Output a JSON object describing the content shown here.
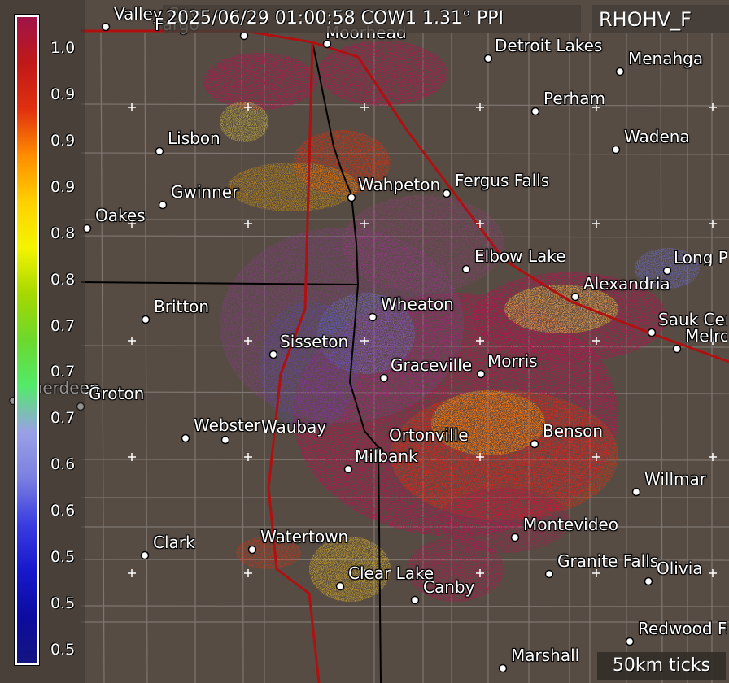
{
  "header": {
    "title": "2025/06/29 01:00:58 COW1 1.31° PPI",
    "product": "RHOHV_F",
    "scale_note": "50km ticks"
  },
  "legend": {
    "ticks": [
      "1.0",
      "0.9",
      "0.9",
      "0.9",
      "0.8",
      "0.8",
      "0.7",
      "0.7",
      "0.7",
      "0.6",
      "0.6",
      "0.5",
      "0.5",
      "0.5"
    ],
    "colors": [
      "#a0144a",
      "#c01818",
      "#e03010",
      "#ff8c00",
      "#ffd000",
      "#f4f400",
      "#a6d800",
      "#6cd82c",
      "#52ea6a",
      "#9aa0e6",
      "#7a80e0",
      "#3a3ce0",
      "#1818cc",
      "#0c0ca0",
      "#141480"
    ]
  },
  "cities": [
    {
      "name": "Valley City"
    },
    {
      "name": "Fargo"
    },
    {
      "name": "Moorhead"
    },
    {
      "name": "Detroit Lakes"
    },
    {
      "name": "Menahga"
    },
    {
      "name": "Perham"
    },
    {
      "name": "Lisbon"
    },
    {
      "name": "Wadena"
    },
    {
      "name": "Gwinner"
    },
    {
      "name": "Wahpeton"
    },
    {
      "name": "Fergus Falls"
    },
    {
      "name": "Oakes"
    },
    {
      "name": "Elbow Lake"
    },
    {
      "name": "Long Prairie"
    },
    {
      "name": "Alexandria"
    },
    {
      "name": "Britton"
    },
    {
      "name": "Wheaton"
    },
    {
      "name": "Sauk Centre"
    },
    {
      "name": "Melrose"
    },
    {
      "name": "Sisseton"
    },
    {
      "name": "Graceville"
    },
    {
      "name": "Morris"
    },
    {
      "name": "Aberdeen"
    },
    {
      "name": "Groton"
    },
    {
      "name": "Webster"
    },
    {
      "name": "Waubay"
    },
    {
      "name": "Ortonville"
    },
    {
      "name": "Benson"
    },
    {
      "name": "Milbank"
    },
    {
      "name": "Willmar"
    },
    {
      "name": "Montevideo"
    },
    {
      "name": "Clark"
    },
    {
      "name": "Watertown"
    },
    {
      "name": "Granite Falls"
    },
    {
      "name": "Olivia"
    },
    {
      "name": "Clear Lake"
    },
    {
      "name": "Canby"
    },
    {
      "name": "Redwood Falls"
    },
    {
      "name": "Marshall"
    }
  ],
  "colors": {
    "background": "#574c44",
    "highway": "#b01010",
    "county": "#7e7670",
    "state": "#000000"
  }
}
